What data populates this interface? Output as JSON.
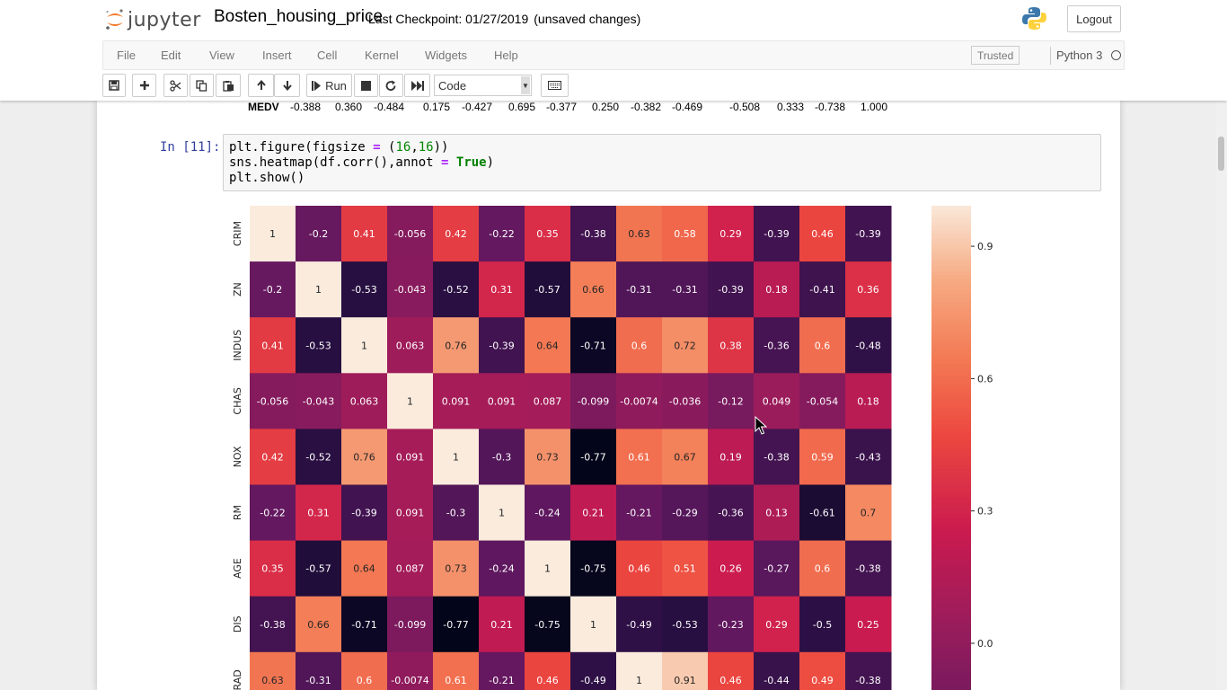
{
  "header": {
    "logo_text": "jupyter",
    "notebook_name": "Bosten_housing_price",
    "checkpoint": "Last Checkpoint: 01/27/2019",
    "unsaved": "(unsaved changes)",
    "logout_label": "Logout"
  },
  "menubar": {
    "items": [
      "File",
      "Edit",
      "View",
      "Insert",
      "Cell",
      "Kernel",
      "Widgets",
      "Help"
    ],
    "trusted": "Trusted",
    "kernel_name": "Python 3"
  },
  "toolbar": {
    "run_label": "Run",
    "cell_type": "Code"
  },
  "previous_output": {
    "label": "MEDV",
    "values": [
      "-0.388",
      "0.360",
      "-0.484",
      "0.175",
      "-0.427",
      "0.695",
      "-0.377",
      "0.250",
      "-0.382",
      "-0.469",
      "-0.508",
      "0.333",
      "-0.738",
      "1.000"
    ]
  },
  "cell": {
    "prompt": "In [11]:",
    "lines": [
      [
        [
          "plt.figure(figsize ",
          ""
        ],
        [
          "=",
          "op"
        ],
        [
          " (",
          ""
        ],
        [
          "16",
          "num"
        ],
        [
          ",",
          ""
        ],
        [
          "16",
          "num"
        ],
        [
          "))",
          ""
        ]
      ],
      [
        [
          "sns.heatmap(df.corr(),annot ",
          ""
        ],
        [
          "=",
          "op"
        ],
        [
          " ",
          ""
        ],
        [
          "True",
          "kw"
        ],
        [
          ")",
          ""
        ]
      ],
      [
        [
          "plt.show()",
          ""
        ]
      ]
    ]
  },
  "chart_data": {
    "type": "heatmap",
    "row_labels": [
      "CRIM",
      "ZN",
      "INDUS",
      "CHAS",
      "NOX",
      "RM",
      "AGE",
      "DIS",
      "RAD"
    ],
    "columns_visible": 14,
    "values": [
      [
        "1",
        "-0.2",
        "0.41",
        "-0.056",
        "0.42",
        "-0.22",
        "0.35",
        "-0.38",
        "0.63",
        "0.58",
        "0.29",
        "-0.39",
        "0.46",
        "-0.39"
      ],
      [
        "-0.2",
        "1",
        "-0.53",
        "-0.043",
        "-0.52",
        "0.31",
        "-0.57",
        "0.66",
        "-0.31",
        "-0.31",
        "-0.39",
        "0.18",
        "-0.41",
        "0.36"
      ],
      [
        "0.41",
        "-0.53",
        "1",
        "0.063",
        "0.76",
        "-0.39",
        "0.64",
        "-0.71",
        "0.6",
        "0.72",
        "0.38",
        "-0.36",
        "0.6",
        "-0.48"
      ],
      [
        "-0.056",
        "-0.043",
        "0.063",
        "1",
        "0.091",
        "0.091",
        "0.087",
        "-0.099",
        "-0.0074",
        "-0.036",
        "-0.12",
        "0.049",
        "-0.054",
        "0.18"
      ],
      [
        "0.42",
        "-0.52",
        "0.76",
        "0.091",
        "1",
        "-0.3",
        "0.73",
        "-0.77",
        "0.61",
        "0.67",
        "0.19",
        "-0.38",
        "0.59",
        "-0.43"
      ],
      [
        "-0.22",
        "0.31",
        "-0.39",
        "0.091",
        "-0.3",
        "1",
        "-0.24",
        "0.21",
        "-0.21",
        "-0.29",
        "-0.36",
        "0.13",
        "-0.61",
        "0.7"
      ],
      [
        "0.35",
        "-0.57",
        "0.64",
        "0.087",
        "0.73",
        "-0.24",
        "1",
        "-0.75",
        "0.46",
        "0.51",
        "0.26",
        "-0.27",
        "0.6",
        "-0.38"
      ],
      [
        "-0.38",
        "0.66",
        "-0.71",
        "-0.099",
        "-0.77",
        "0.21",
        "-0.75",
        "1",
        "-0.49",
        "-0.53",
        "-0.23",
        "0.29",
        "-0.5",
        "0.25"
      ],
      [
        "0.63",
        "-0.31",
        "0.6",
        "-0.0074",
        "0.61",
        "-0.21",
        "0.46",
        "-0.49",
        "1",
        "0.91",
        "0.46",
        "-0.44",
        "0.49",
        "-0.38"
      ]
    ],
    "colorbar_ticks": [
      "0.9",
      "0.6",
      "0.3",
      "0.0"
    ],
    "colorbar_tick_values": [
      0.9,
      0.6,
      0.3,
      0.0
    ],
    "vmin": -0.77,
    "vmax": 1.0,
    "colormap": "rocket"
  },
  "colors": {
    "prompt": "#303f9f",
    "link_muted": "#777777",
    "panel_bg": "#ffffff",
    "page_bg": "#eeeeee"
  }
}
